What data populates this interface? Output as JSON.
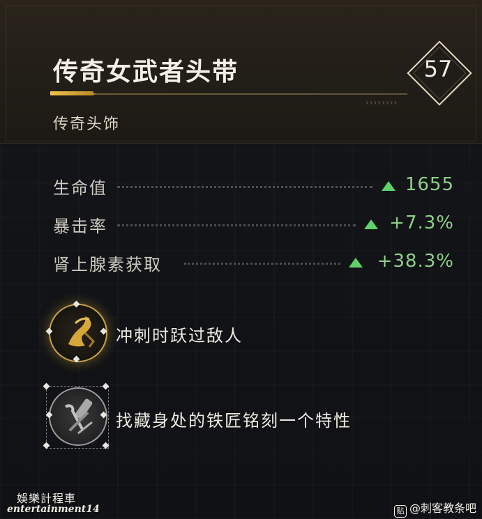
{
  "item": {
    "name": "传奇女武者头带",
    "type": "传奇头饰",
    "level": "57",
    "chevrons": "››››››››"
  },
  "stats": [
    {
      "label": "生命值",
      "value": "1655"
    },
    {
      "label": "暴击率",
      "value": "+7.3%"
    },
    {
      "label": "肾上腺素获取",
      "value": "+38.3%"
    }
  ],
  "perks": [
    {
      "text": "冲刺时跃过敌人",
      "icon": "leap-icon",
      "color": "#d7a73a"
    },
    {
      "text": "找藏身处的铁匠铭刻一个特性",
      "icon": "blacksmith-tools-icon",
      "color": "#bdbdbd"
    }
  ],
  "watermark": {
    "cn": "娛樂計程車",
    "en": "entertainment14"
  },
  "credit": {
    "badge": "贴",
    "text": "@刺客教条吧"
  },
  "colors": {
    "gold_accent": "#d9ab3b",
    "stat_green": "#8fd08a",
    "arrow_green": "#5fd06a"
  }
}
